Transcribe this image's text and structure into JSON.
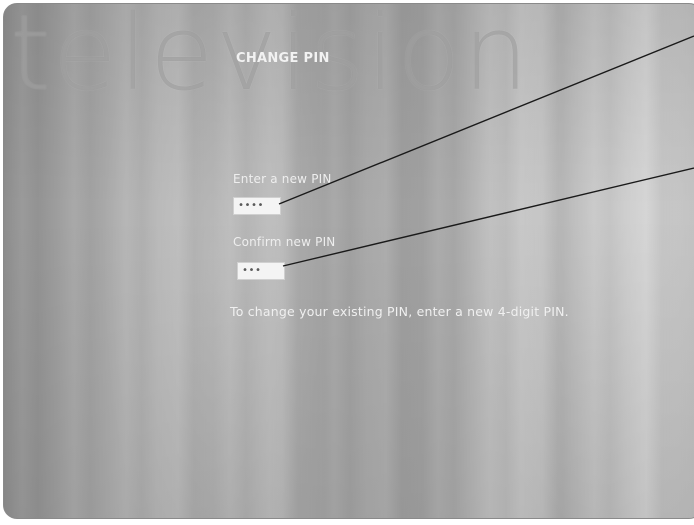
{
  "screen": {
    "watermark_text": "television",
    "title": "CHANGE PIN"
  },
  "form": {
    "new_pin_label": "Enter a new PIN",
    "new_pin_value": "••••",
    "confirm_pin_label": "Confirm new PIN",
    "confirm_pin_value": "•••"
  },
  "help": {
    "text": "To change your existing PIN, enter a new 4-digit PIN."
  },
  "colors": {
    "text": "#f0f0f0",
    "field_bg": "#f4f4f4",
    "callout_line": "#1a1a1a"
  }
}
